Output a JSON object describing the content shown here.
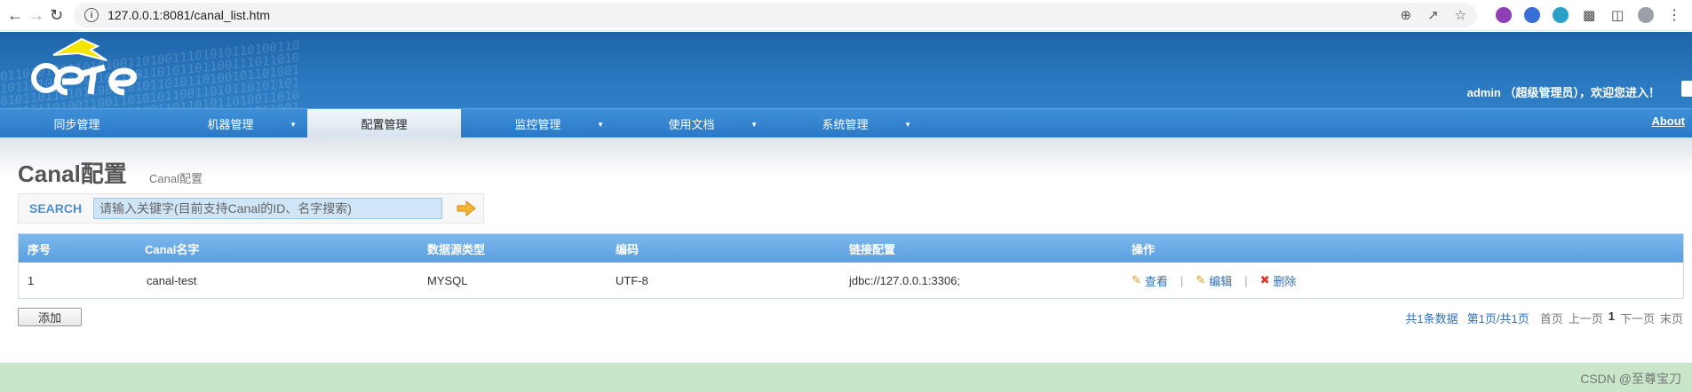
{
  "browser": {
    "url": "127.0.0.1:8081/canal_list.htm"
  },
  "header": {
    "welcome": "admin （超级管理员），欢迎您进入！"
  },
  "menu": {
    "items": [
      {
        "label": "同步管理",
        "dropdown": false,
        "active": false
      },
      {
        "label": "机器管理",
        "dropdown": true,
        "active": false
      },
      {
        "label": "配置管理",
        "dropdown": false,
        "active": true
      },
      {
        "label": "监控管理",
        "dropdown": true,
        "active": false
      },
      {
        "label": "使用文档",
        "dropdown": true,
        "active": false
      },
      {
        "label": "系统管理",
        "dropdown": true,
        "active": false
      }
    ],
    "about": "About"
  },
  "page": {
    "title": "Canal配置",
    "breadcrumb": "Canal配置"
  },
  "search": {
    "label": "SEARCH",
    "placeholder": "请输入关键字(目前支持Canal的ID、名字搜索)"
  },
  "table": {
    "headers": [
      "序号",
      "Canal名字",
      "数据源类型",
      "编码",
      "链接配置",
      "操作"
    ],
    "rows": [
      {
        "id": "1",
        "name": "canal-test",
        "type": "MYSQL",
        "encoding": "UTF-8",
        "link": "jdbc://127.0.0.1:3306;"
      }
    ],
    "actions": {
      "view": "查看",
      "edit": "编辑",
      "delete": "删除",
      "separator": "|"
    }
  },
  "add_button": "添加",
  "pager": {
    "total": "共1条数据",
    "page": "第1页/共1页",
    "first": "首页",
    "prev": "上一页",
    "current": "1",
    "next": "下一页",
    "last": "末页"
  },
  "watermark": "CSDN @至尊宝刀",
  "colors": {
    "banner": "#2a77bf",
    "menu": "#2b79c6",
    "table_header": "#5a9fe0",
    "link": "#2f6fb8",
    "footer": "#c8e6c9"
  }
}
